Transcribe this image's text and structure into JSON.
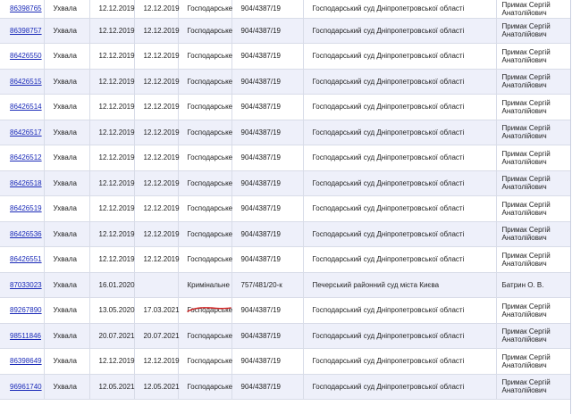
{
  "columns": [
    "document",
    "decision",
    "reg_date",
    "pub_date",
    "jurisdiction",
    "case_no",
    "court",
    "judge"
  ],
  "rows": [
    {
      "doc": "86398765",
      "form": "Ухвала",
      "reg": "12.12.2019",
      "pub": "12.12.2019",
      "kind": "Господарське",
      "case": "904/4387/19",
      "court": "Господарський суд Дніпропетровської області",
      "judge": "Примак Сергій Анатолійович"
    },
    {
      "doc": "86398757",
      "form": "Ухвала",
      "reg": "12.12.2019",
      "pub": "12.12.2019",
      "kind": "Господарське",
      "case": "904/4387/19",
      "court": "Господарський суд Дніпропетровської області",
      "judge": "Примак Сергій Анатолійович"
    },
    {
      "doc": "86426550",
      "form": "Ухвала",
      "reg": "12.12.2019",
      "pub": "12.12.2019",
      "kind": "Господарське",
      "case": "904/4387/19",
      "court": "Господарський суд Дніпропетровської області",
      "judge": "Примак Сергій Анатолійович"
    },
    {
      "doc": "86426515",
      "form": "Ухвала",
      "reg": "12.12.2019",
      "pub": "12.12.2019",
      "kind": "Господарське",
      "case": "904/4387/19",
      "court": "Господарський суд Дніпропетровської області",
      "judge": "Примак Сергій Анатолійович"
    },
    {
      "doc": "86426514",
      "form": "Ухвала",
      "reg": "12.12.2019",
      "pub": "12.12.2019",
      "kind": "Господарське",
      "case": "904/4387/19",
      "court": "Господарський суд Дніпропетровської області",
      "judge": "Примак Сергій Анатолійович"
    },
    {
      "doc": "86426517",
      "form": "Ухвала",
      "reg": "12.12.2019",
      "pub": "12.12.2019",
      "kind": "Господарське",
      "case": "904/4387/19",
      "court": "Господарський суд Дніпропетровської області",
      "judge": "Примак Сергій Анатолійович"
    },
    {
      "doc": "86426512",
      "form": "Ухвала",
      "reg": "12.12.2019",
      "pub": "12.12.2019",
      "kind": "Господарське",
      "case": "904/4387/19",
      "court": "Господарський суд Дніпропетровської області",
      "judge": "Примак Сергій Анатолійович"
    },
    {
      "doc": "86426518",
      "form": "Ухвала",
      "reg": "12.12.2019",
      "pub": "12.12.2019",
      "kind": "Господарське",
      "case": "904/4387/19",
      "court": "Господарський суд Дніпропетровської області",
      "judge": "Примак Сергій Анатолійович"
    },
    {
      "doc": "86426519",
      "form": "Ухвала",
      "reg": "12.12.2019",
      "pub": "12.12.2019",
      "kind": "Господарське",
      "case": "904/4387/19",
      "court": "Господарський суд Дніпропетровської області",
      "judge": "Примак Сергій Анатолійович"
    },
    {
      "doc": "86426536",
      "form": "Ухвала",
      "reg": "12.12.2019",
      "pub": "12.12.2019",
      "kind": "Господарське",
      "case": "904/4387/19",
      "court": "Господарський суд Дніпропетровської області",
      "judge": "Примак Сергій Анатолійович"
    },
    {
      "doc": "86426551",
      "form": "Ухвала",
      "reg": "12.12.2019",
      "pub": "12.12.2019",
      "kind": "Господарське",
      "case": "904/4387/19",
      "court": "Господарський суд Дніпропетровської області",
      "judge": "Примак Сергій Анатолійович"
    },
    {
      "doc": "87033023",
      "form": "Ухвала",
      "reg": "16.01.2020",
      "pub": "",
      "kind": "Кримінальне",
      "case": "757/481/20-к",
      "court": "Печерський районний суд міста Києва",
      "judge": "Батрин О. В."
    },
    {
      "doc": "89267890",
      "form": "Ухвала",
      "reg": "13.05.2020",
      "pub": "17.03.2021",
      "kind": "Господарське",
      "case": "904/4387/19",
      "court": "Господарський суд Дніпропетровської області",
      "judge": "Примак Сергій Анатолійович"
    },
    {
      "doc": "98511846",
      "form": "Ухвала",
      "reg": "20.07.2021",
      "pub": "20.07.2021",
      "kind": "Господарське",
      "case": "904/4387/19",
      "court": "Господарський суд Дніпропетровської області",
      "judge": "Примак Сергій Анатолійович"
    },
    {
      "doc": "86398649",
      "form": "Ухвала",
      "reg": "12.12.2019",
      "pub": "12.12.2019",
      "kind": "Господарське",
      "case": "904/4387/19",
      "court": "Господарський суд Дніпропетровської області",
      "judge": "Примак Сергій Анатолійович"
    },
    {
      "doc": "96961740",
      "form": "Ухвала",
      "reg": "12.05.2021",
      "pub": "12.05.2021",
      "kind": "Господарське",
      "case": "904/4387/19",
      "court": "Господарський суд Дніпропетровської області",
      "judge": "Примак Сергій Анатолійович"
    }
  ],
  "colors": {
    "link": "#1a2ab8",
    "row_alt": "#eef0fa",
    "annotation": "#d42020"
  }
}
